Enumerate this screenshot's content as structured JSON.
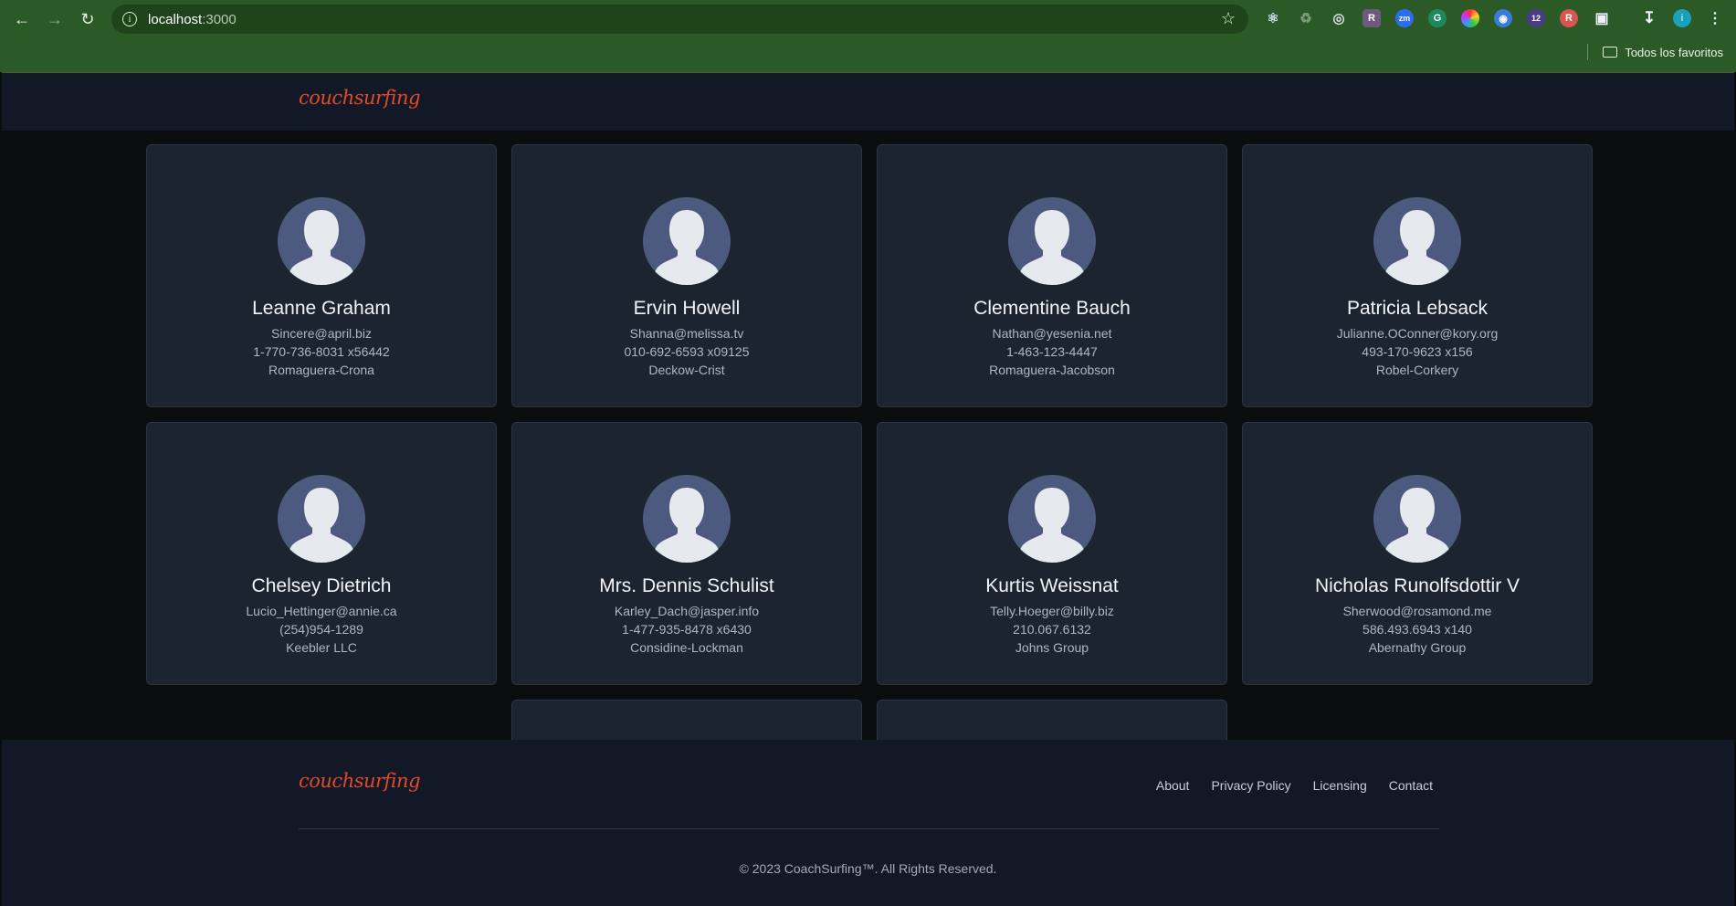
{
  "browser": {
    "url_host": "localhost",
    "url_port": ":3000",
    "bookmarks_folder": "Todos los favoritos",
    "profile_initial": "i",
    "extension_badge": "12"
  },
  "navbar": {
    "logo_text": "couchsurfing"
  },
  "users": [
    {
      "name": "Leanne Graham",
      "email": "Sincere@april.biz",
      "phone": "1-770-736-8031 x56442",
      "company": "Romaguera-Crona"
    },
    {
      "name": "Ervin Howell",
      "email": "Shanna@melissa.tv",
      "phone": "010-692-6593 x09125",
      "company": "Deckow-Crist"
    },
    {
      "name": "Clementine Bauch",
      "email": "Nathan@yesenia.net",
      "phone": "1-463-123-4447",
      "company": "Romaguera-Jacobson"
    },
    {
      "name": "Patricia Lebsack",
      "email": "Julianne.OConner@kory.org",
      "phone": "493-170-9623 x156",
      "company": "Robel-Corkery"
    },
    {
      "name": "Chelsey Dietrich",
      "email": "Lucio_Hettinger@annie.ca",
      "phone": "(254)954-1289",
      "company": "Keebler LLC"
    },
    {
      "name": "Mrs. Dennis Schulist",
      "email": "Karley_Dach@jasper.info",
      "phone": "1-477-935-8478 x6430",
      "company": "Considine-Lockman"
    },
    {
      "name": "Kurtis Weissnat",
      "email": "Telly.Hoeger@billy.biz",
      "phone": "210.067.6132",
      "company": "Johns Group"
    },
    {
      "name": "Nicholas Runolfsdottir V",
      "email": "Sherwood@rosamond.me",
      "phone": "586.493.6943 x140",
      "company": "Abernathy Group"
    }
  ],
  "footer": {
    "logo_text": "couchsurfing",
    "links": [
      "About",
      "Privacy Policy",
      "Licensing",
      "Contact"
    ],
    "copyright": "© 2023 CoachSurfing™. All Rights Reserved."
  },
  "colors": {
    "brand": "#e04a2a",
    "chrome": "#2b5a26",
    "card": "#1c2430",
    "avatar": "#4d5a80"
  }
}
